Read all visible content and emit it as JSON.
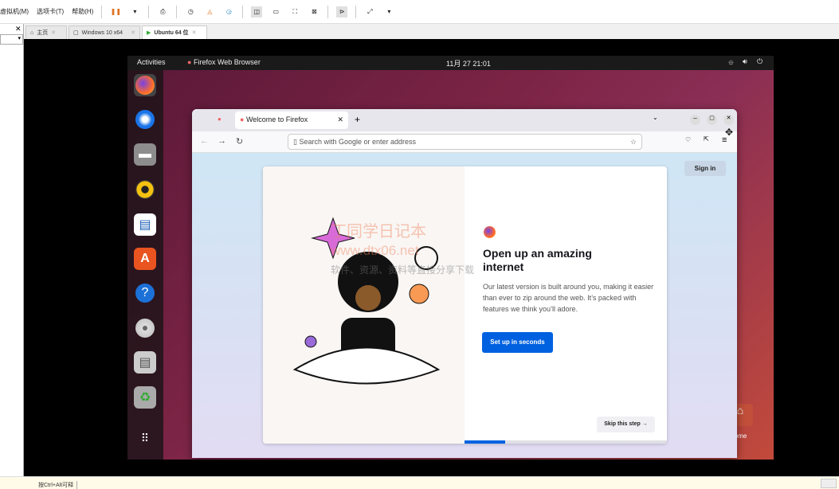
{
  "vmware": {
    "menu": [
      "虚拟机(M)",
      "选项卡(T)",
      "帮助(H)"
    ],
    "tabs": [
      {
        "label": "主页"
      },
      {
        "label": "Windows 10 x64"
      },
      {
        "label": "Ubuntu 64 位"
      }
    ],
    "status_text": "按Ctrl+Alt可释"
  },
  "ubuntu": {
    "activities": "Activities",
    "app_name": "Firefox Web Browser",
    "clock": "11月 27  21:01",
    "desktop_home": "Home"
  },
  "firefox": {
    "tab_title": "Welcome to Firefox",
    "address_placeholder": "Search with Google or enter address",
    "sign_in": "Sign in",
    "heading": "Open up an amazing internet",
    "body": "Our latest version is built around you, making it easier than ever to zip around the web. It’s packed with features we think you’ll adore.",
    "cta": "Set up in seconds",
    "skip": "Skip this step →",
    "progress": 0.2
  },
  "watermark": {
    "line1": "丁同学日记本",
    "line2": "www.dtx06.net",
    "line3": "软件、资源、资料等直接分享下载"
  }
}
